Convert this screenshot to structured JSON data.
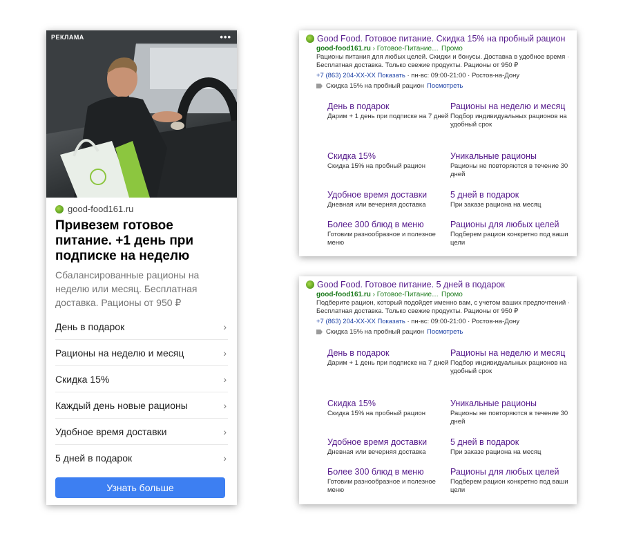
{
  "mobile": {
    "ad_label": "РЕКЛАМА",
    "more_label": "•••",
    "domain": "good-food161.ru",
    "title": "Привезем готовое питание. +1 день при подписке на неделю",
    "description": "Сбалансированные рационы на неделю или месяц. Бесплатная доставка. Рационы от 950 ₽",
    "chevron": "›",
    "items": [
      "День в подарок",
      "Рационы на неделю и месяц",
      "Скидка 15%",
      "Каждый день новые рационы",
      "Удобное время доставки",
      "5 дней в подарок"
    ],
    "button_label": "Узнать больше"
  },
  "ads": [
    {
      "title": "Good Food. Готовое питание. Скидка 15% на пробный рацион",
      "domain": "good-food161.ru",
      "path": " › Готовое-Питание…",
      "promo": "Промо",
      "description": "Рационы питания для любых целей. Скидки и бонусы. Доставка в удобное время · Бесплатная доставка. Только свежие продукты. Рационы от 950 ₽",
      "phone": "+7 (863) 204-XX-XX Показать",
      "hours": " · пн-вс: 09:00-21:00 · Ростов-на-Дону",
      "promo_text": "Скидка 15% на пробный рацион",
      "promo_link": "Посмотреть",
      "sitelinks": [
        {
          "title": "День в подарок",
          "desc": "Дарим + 1 день при подписке на 7 дней"
        },
        {
          "title": "Рационы на неделю и месяц",
          "desc": "Подбор индивидуальных рационов на удобный срок"
        },
        {
          "title": "Скидка 15%",
          "desc": "Скидка 15% на пробный рацион"
        },
        {
          "title": "Уникальные рационы",
          "desc": "Рационы не повторяются в течение 30 дней"
        },
        {
          "title": "Удобное время доставки",
          "desc": "Дневная или вечерняя доставка"
        },
        {
          "title": "5 дней в подарок",
          "desc": "При заказе рациона на месяц"
        },
        {
          "title": "Более 300 блюд в меню",
          "desc": "Готовим разнообразное и полезное меню"
        },
        {
          "title": "Рационы для любых целей",
          "desc": "Подберем рацион конкретно под ваши цели"
        }
      ]
    },
    {
      "title": "Good Food. Готовое питание. 5 дней в подарок",
      "domain": "good-food161.ru",
      "path": " › Готовое-Питание…",
      "promo": "Промо",
      "description": "Подберите рацион, который подойдет именно вам, с учетом ваших предпочтений · Бесплатная доставка. Только свежие продукты. Рационы от 950 ₽",
      "phone": "+7 (863) 204-XX-XX Показать",
      "hours": " · пн-вс: 09:00-21:00 · Ростов-на-Дону",
      "promo_text": "Скидка 15% на пробный рацион",
      "promo_link": "Посмотреть",
      "sitelinks": [
        {
          "title": "День в подарок",
          "desc": "Дарим + 1 день при подписке на 7 дней"
        },
        {
          "title": "Рационы на неделю и месяц",
          "desc": "Подбор индивидуальных рационов на удобный срок"
        },
        {
          "title": "Скидка 15%",
          "desc": "Скидка 15% на пробный рацион"
        },
        {
          "title": "Уникальные рационы",
          "desc": "Рационы не повторяются в течение 30 дней"
        },
        {
          "title": "Удобное время доставки",
          "desc": "Дневная или вечерняя доставка"
        },
        {
          "title": "5 дней в подарок",
          "desc": "При заказе рациона на месяц"
        },
        {
          "title": "Более 300 блюд в меню",
          "desc": "Готовим разнообразное и полезное меню"
        },
        {
          "title": "Рационы для любых целей",
          "desc": "Подберем рацион конкретно под ваши цели"
        }
      ]
    }
  ],
  "colors": {
    "button": "#3d7ff2",
    "title_link": "#551a8b",
    "url_green": "#1b7a1b",
    "contact_link": "#1a3fa3"
  }
}
